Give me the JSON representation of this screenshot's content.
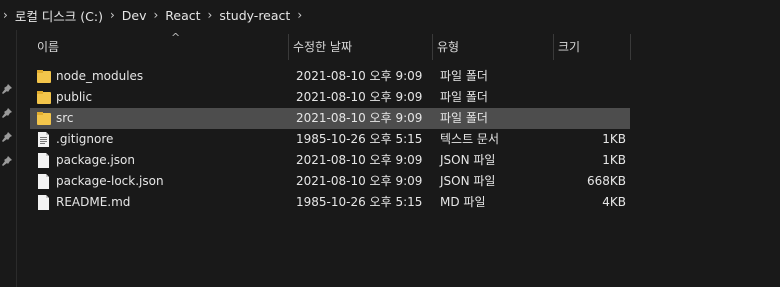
{
  "breadcrumb": {
    "items": [
      "로컬 디스크 (C:)",
      "Dev",
      "React",
      "study-react"
    ]
  },
  "columns": {
    "name": "이름",
    "modified": "수정한 날짜",
    "type": "유형",
    "size": "크기"
  },
  "files": [
    {
      "name": "node_modules",
      "modified": "2021-08-10 오후 9:09",
      "type": "파일 폴더",
      "size": "",
      "icon": "folder-icon"
    },
    {
      "name": "public",
      "modified": "2021-08-10 오후 9:09",
      "type": "파일 폴더",
      "size": "",
      "icon": "folder-icon"
    },
    {
      "name": "src",
      "modified": "2021-08-10 오후 9:09",
      "type": "파일 폴더",
      "size": "",
      "icon": "folder-icon",
      "selected": true
    },
    {
      "name": ".gitignore",
      "modified": "1985-10-26 오후 5:15",
      "type": "텍스트 문서",
      "size": "1KB",
      "icon": "text-file-icon"
    },
    {
      "name": "package.json",
      "modified": "2021-08-10 오후 9:09",
      "type": "JSON 파일",
      "size": "1KB",
      "icon": "file-icon"
    },
    {
      "name": "package-lock.json",
      "modified": "2021-08-10 오후 9:09",
      "type": "JSON 파일",
      "size": "668KB",
      "icon": "file-icon"
    },
    {
      "name": "README.md",
      "modified": "1985-10-26 오후 5:15",
      "type": "MD 파일",
      "size": "4KB",
      "icon": "file-icon"
    }
  ],
  "colors": {
    "background": "#191919",
    "selected_row": "#4d4d4d",
    "folder": "#f3c54b"
  }
}
